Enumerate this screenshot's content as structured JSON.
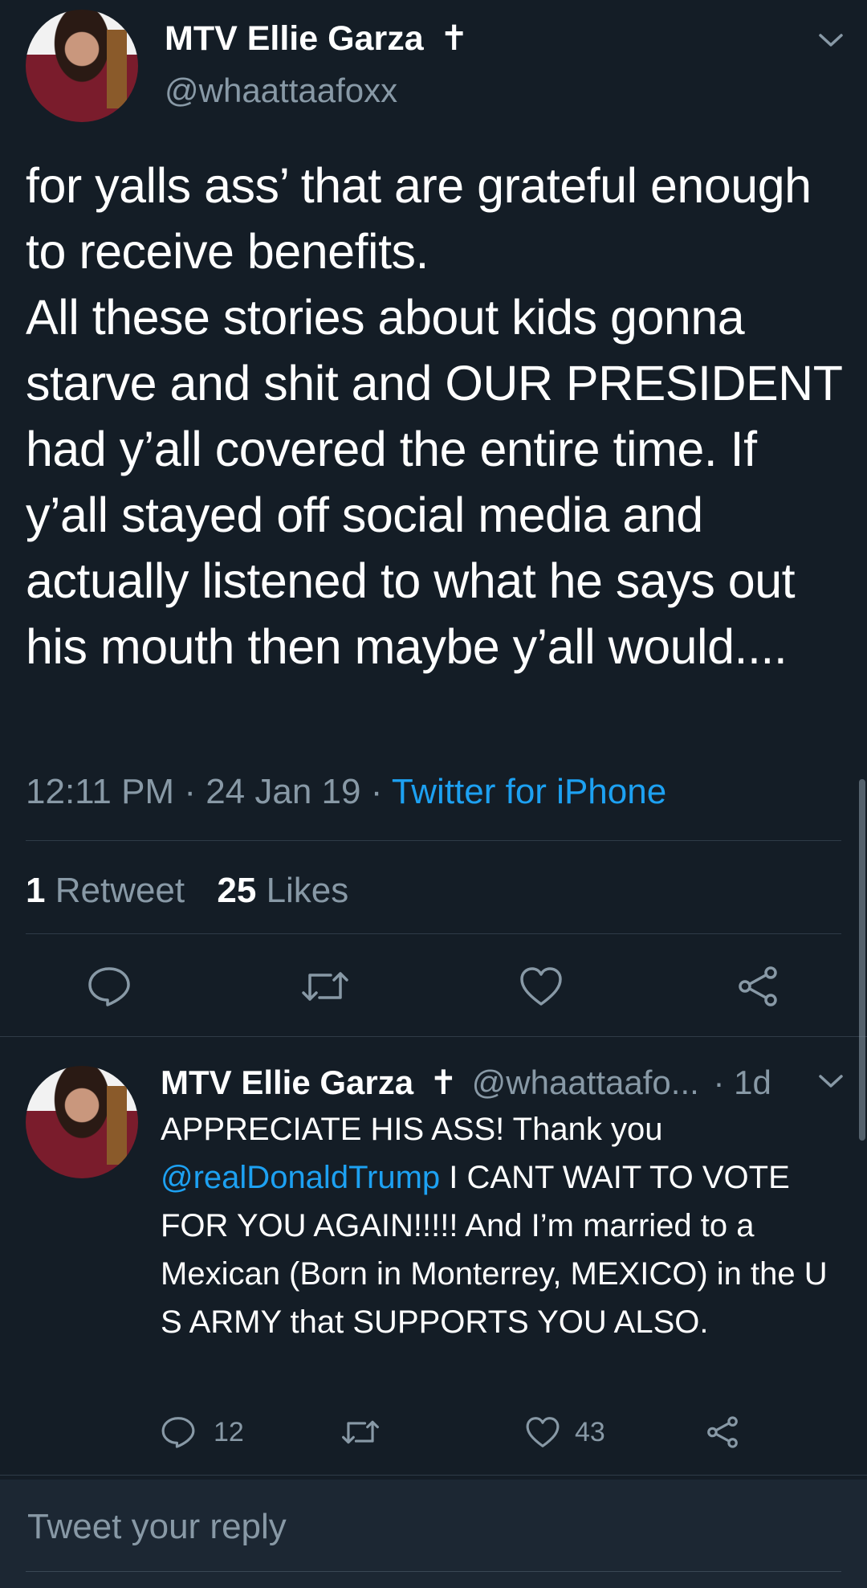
{
  "main_tweet": {
    "display_name": "MTV Ellie Garza",
    "name_symbol": "✝",
    "handle": "@whaattaafoxx",
    "text": "for yalls ass’ that are grateful enough to receive benefits.\nAll these stories about kids gonna starve and shit and OUR PRESIDENT had y’all covered the entire time. If y’all stayed off social media and actually listened to what he says out his mouth then maybe y’all would....",
    "time": "12:11 PM",
    "date": "24 Jan 19",
    "source": "Twitter for iPhone",
    "retweet_count": "1",
    "retweet_label": "Retweet",
    "like_count": "25",
    "like_label": "Likes"
  },
  "reply_tweet": {
    "display_name": "MTV Ellie Garza",
    "name_symbol": "✝",
    "handle": "@whaattaafo...",
    "age": "· 1d",
    "text_before": "APPRECIATE HIS ASS! Thank you ",
    "mention": "@realDonaldTrump",
    "text_after": " I CANT WAIT TO VOTE FOR YOU AGAIN!!!!! And I’m married to a Mexican (Born in Monterrey, MEXICO) in the U S ARMY that SUPPORTS YOU ALSO.",
    "reply_count": "12",
    "like_count": "43"
  },
  "composer": {
    "placeholder": "Tweet your reply"
  },
  "colors": {
    "background": "#141d26",
    "muted": "#8899a6",
    "link": "#1da1f2",
    "divider": "#2f3b47"
  }
}
